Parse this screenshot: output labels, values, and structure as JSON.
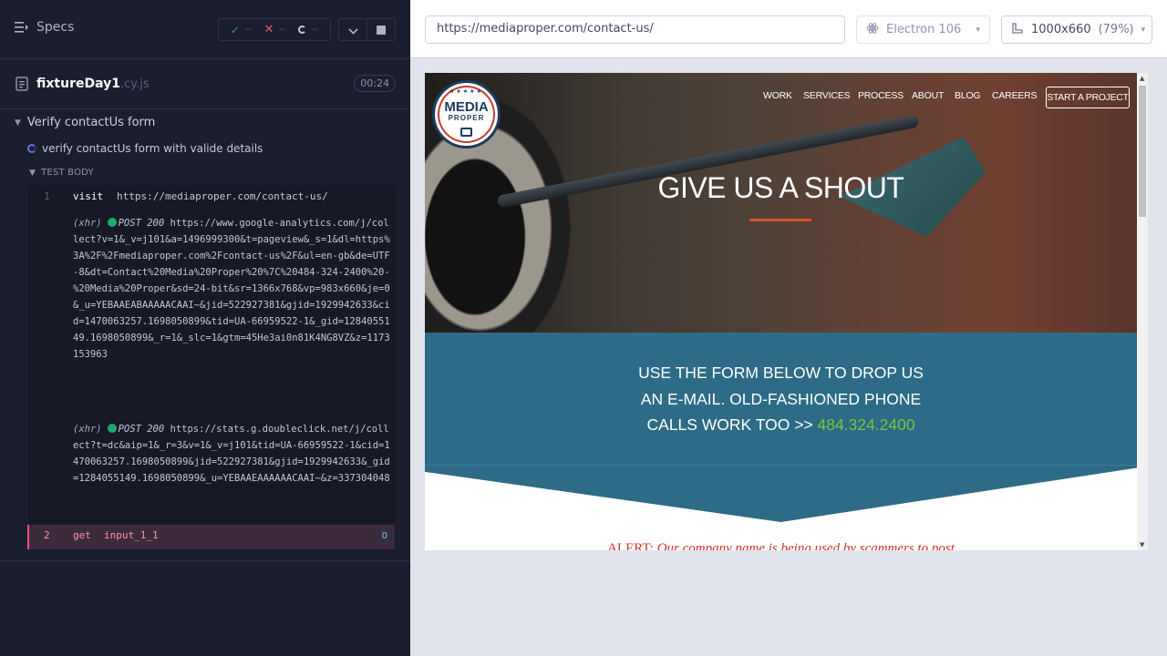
{
  "reporter": {
    "specs_label": "Specs",
    "stats": {
      "passed": "--",
      "failed": "--",
      "pending": "--"
    },
    "file": {
      "name": "fixtureDay1",
      "ext": ".cy.js",
      "duration": "00:24"
    },
    "suite": "Verify contactUs form",
    "test": "verify contactUs form with valide details",
    "test_body_label": "TEST BODY",
    "commands": [
      {
        "num": "1",
        "name": "visit",
        "message": "https://mediaproper.com/contact-us/"
      },
      {
        "num": "2",
        "name": "get",
        "message": "input_1_1",
        "badge": "0"
      }
    ],
    "xhr_logs": [
      {
        "tag": "(xhr)",
        "method": "POST 200",
        "url": "https://www.google-analytics.com/j/collect?v=1&_v=j101&a=1496999300&t=pageview&_s=1&dl=https%3A%2F%2Fmediaproper.com%2Fcontact-us%2F&ul=en-gb&de=UTF-8&dt=Contact%20Media%20Proper%20%7C%20484-324-2400%20-%20Media%20Proper&sd=24-bit&sr=1366x768&vp=983x660&je=0&_u=YEBAAEABAAAAACAAI~&jid=522927381&gjid=1929942633&cid=1470063257.1698050899&tid=UA-66959522-1&_gid=1284055149.1698050899&_r=1&_slc=1&gtm=45He3ai0n81K4NG8VZ&z=1173153963"
      },
      {
        "tag": "(xhr)",
        "method": "POST 200",
        "url": "https://stats.g.doubleclick.net/j/collect?t=dc&aip=1&_r=3&v=1&_v=j101&tid=UA-66959522-1&cid=1470063257.1698050899&jid=522927381&gjid=1929942633&_gid=1284055149.1698050899&_u=YEBAAEAAAAAACAAI~&z=337304048"
      }
    ]
  },
  "aut": {
    "url": "https://mediaproper.com/contact-us/",
    "browser": "Electron 106",
    "viewport": "1000x660",
    "zoom": "(79%)"
  },
  "site": {
    "logo": {
      "line1": "MEDIA",
      "line2": "PROPER",
      "stars": "★★★★★"
    },
    "nav": [
      "WORK",
      "SERVICES",
      "PROCESS",
      "ABOUT",
      "BLOG",
      "CAREERS"
    ],
    "cta": "START A PROJECT",
    "hero_title": "GIVE US A SHOUT",
    "band_lines": [
      "USE THE FORM BELOW TO DROP US",
      "AN E-MAIL. OLD-FASHIONED PHONE",
      "CALLS WORK TOO >> "
    ],
    "phone": "484.324.2400",
    "alert_lead": "ALERT:",
    "alert_text": " Our company name is being used by scammers to post"
  },
  "colors": {
    "reporter_bg": "#1b1e2e",
    "pass": "#1fa971",
    "fail": "#e45770",
    "band": "#2d6b87",
    "phone": "#7ec241",
    "alert": "#d0341f",
    "accent_underline": "#d9512c"
  }
}
